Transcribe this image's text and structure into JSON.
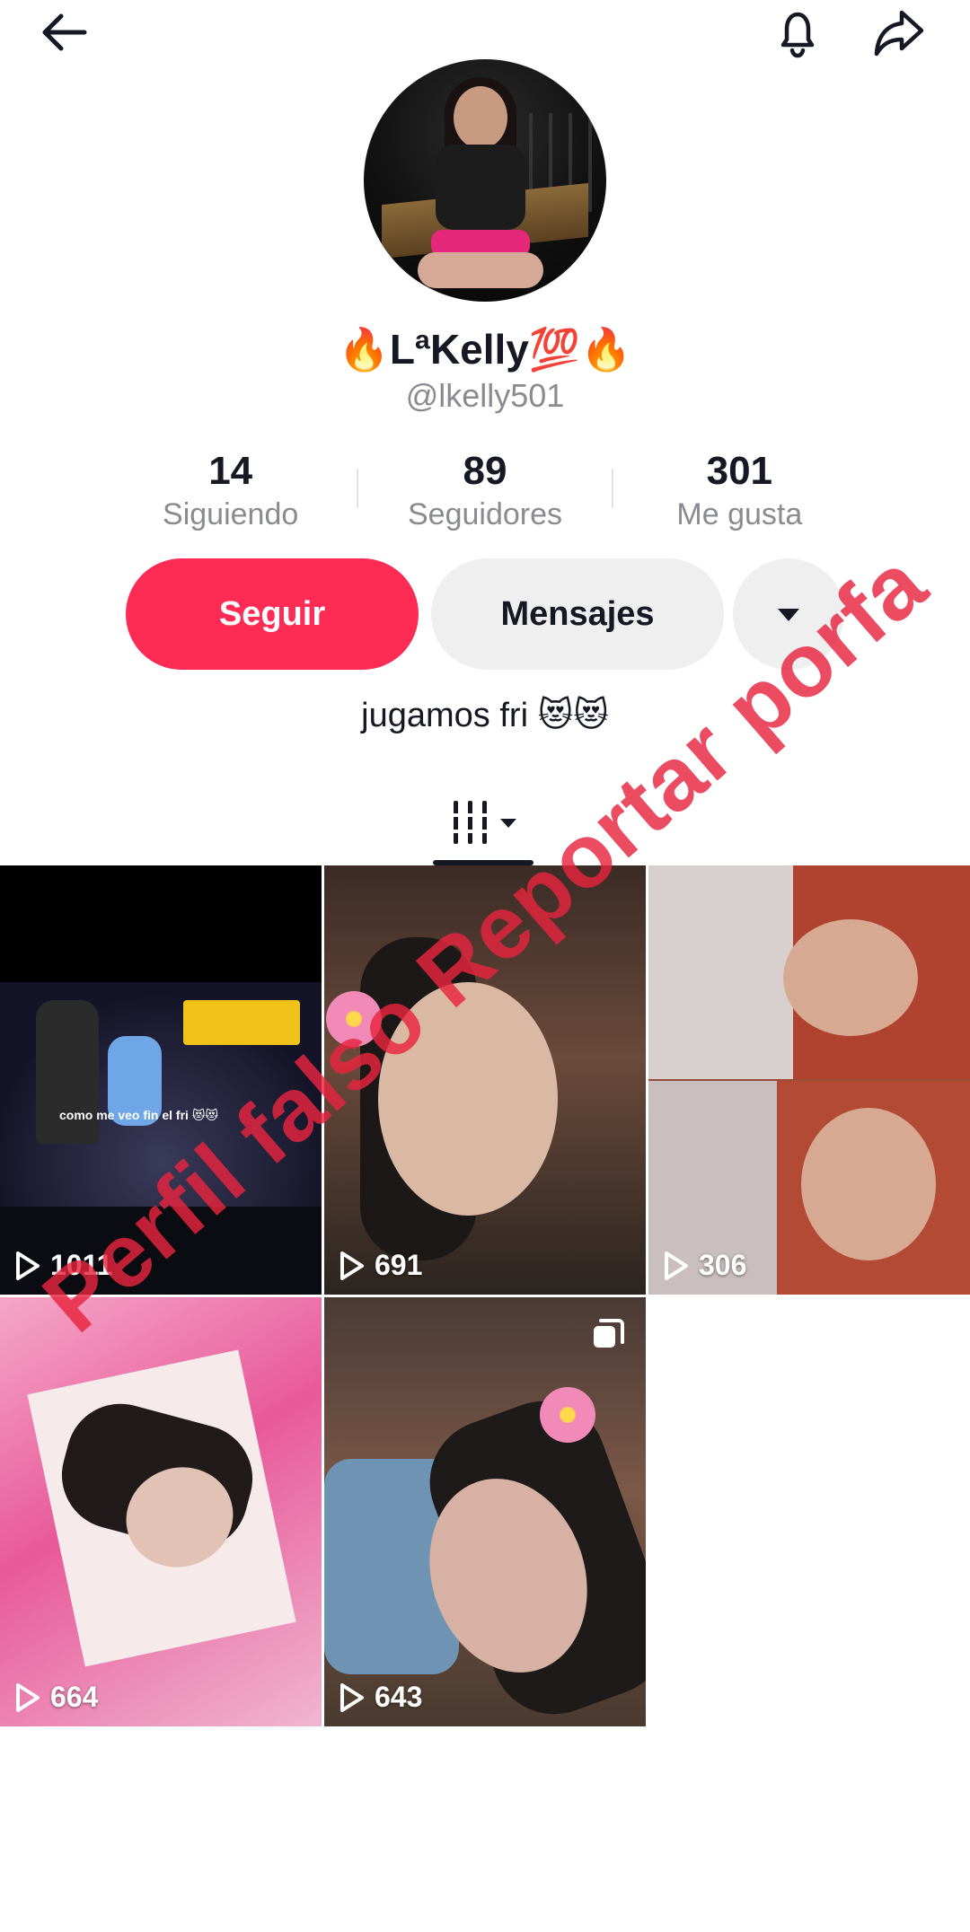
{
  "header": {
    "back_icon": "arrow-left-icon",
    "bell_icon": "bell-icon",
    "share_icon": "share-arrow-icon"
  },
  "profile": {
    "display_name": "🔥LªKelly💯🔥",
    "username": "@lkelly501",
    "bio": "jugamos fri 😻😻"
  },
  "stats": [
    {
      "value": "14",
      "label": "Siguiendo"
    },
    {
      "value": "89",
      "label": "Seguidores"
    },
    {
      "value": "301",
      "label": "Me gusta"
    }
  ],
  "actions": {
    "follow_label": "Seguir",
    "message_label": "Mensajes",
    "more_icon": "caret-down-icon"
  },
  "tabs": {
    "videos_icon": "grid-bars-icon"
  },
  "videos": [
    {
      "views": "1011",
      "overlay_text": "como me veo fin el fri 😻😻"
    },
    {
      "views": "691"
    },
    {
      "views": "306"
    },
    {
      "views": "664"
    },
    {
      "views": "643",
      "multi_icon": "photo-stack-icon"
    }
  ],
  "watermark": "Perfil falso Reportar porfa",
  "colors": {
    "follow_button": "#fe2c55",
    "secondary_button": "#efeff0",
    "watermark": "#e8243e",
    "muted_text": "#8a8b91"
  }
}
